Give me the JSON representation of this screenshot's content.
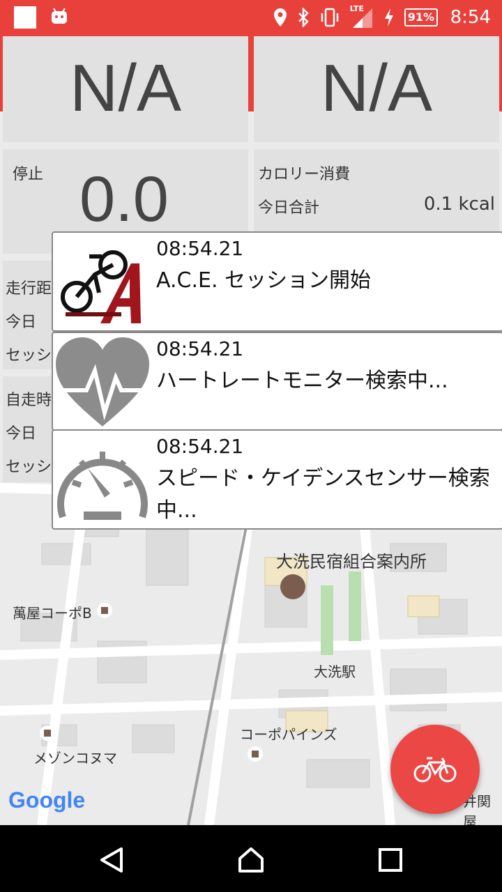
{
  "status_bar": {
    "battery": "91%",
    "network": "LTE",
    "time": "8:54",
    "icons": [
      "location-icon",
      "bluetooth-icon",
      "vibrate-icon",
      "signal-icon",
      "charging-icon"
    ]
  },
  "stats": {
    "top_left_value": "N/A",
    "top_right_value": "N/A",
    "state_label": "停止",
    "speed_value": "0.0",
    "calorie_title": "カロリー消費",
    "today_total_label": "今日合計",
    "calorie_value": "0.1 kcal",
    "distance_title": "走行距",
    "distance_today_label": "今日",
    "distance_session_label": "セッシ",
    "time_title": "自走時",
    "time_today_label": "今日",
    "time_session_label": "セッシ"
  },
  "notifications": [
    {
      "time": "08:54.21",
      "message": "A.C.E. セッション開始",
      "icon": "ace-bike-logo-icon"
    },
    {
      "time": "08:54.21",
      "message": "ハートレートモニター検索中...",
      "icon": "heart-rate-icon"
    },
    {
      "time": "08:54.21",
      "message": "スピード・ケイデンスセンサー検索中...",
      "icon": "speedometer-icon"
    }
  ],
  "map_labels": {
    "place1": "大洗民宿組合案内所",
    "place2": "萬屋コーポB",
    "place3": "大洗駅",
    "place4": "コーポパインズ",
    "place5": "メゾンコヌマ",
    "place6": "井関屋",
    "google": "Google"
  },
  "fab": {
    "icon": "bicycle-icon"
  },
  "nav": {
    "icons": [
      "back-icon",
      "home-icon",
      "recents-icon"
    ]
  },
  "colors": {
    "accent": "#e8413b",
    "fab": "#ea4745"
  }
}
